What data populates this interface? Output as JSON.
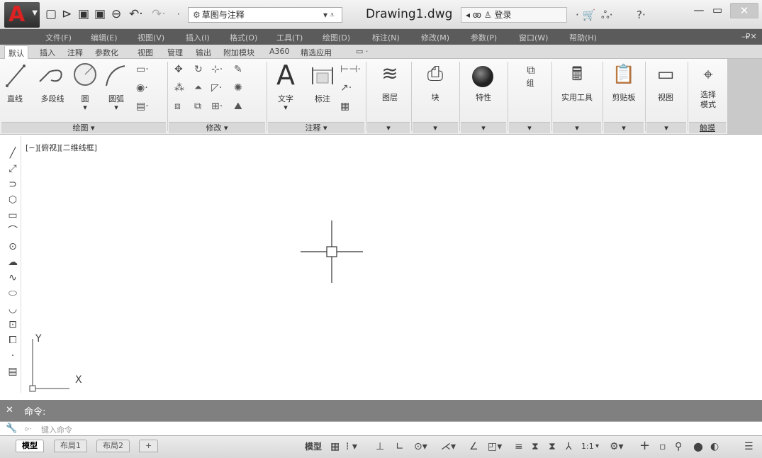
{
  "app": {
    "doc_title": "Drawing1.dwg"
  },
  "qat": {
    "workspace": "草图与注释",
    "search_placeholder": "",
    "login": "登录"
  },
  "menu": [
    "文件(F)",
    "编辑(E)",
    "视图(V)",
    "插入(I)",
    "格式(O)",
    "工具(T)",
    "绘图(D)",
    "标注(N)",
    "修改(M)",
    "参数(P)",
    "窗口(W)",
    "帮助(H)"
  ],
  "tabs": [
    "默认",
    "插入",
    "注释",
    "参数化",
    "视图",
    "管理",
    "输出",
    "附加模块",
    "A360",
    "精选应用"
  ],
  "ribbon": {
    "draw": {
      "line": "直线",
      "polyline": "多段线",
      "circle": "圆",
      "arc": "圆弧",
      "panel": "绘图 ▾"
    },
    "modify": {
      "panel": "修改 ▾"
    },
    "annotation": {
      "text": "文字",
      "dim": "标注",
      "panel": "注释 ▾"
    },
    "layers": "图层",
    "block": "块",
    "properties": "特性",
    "group": "组",
    "utilities": "实用工具",
    "clipboard": "剪贴板",
    "view": "视图",
    "select_mode": "选择\n模式",
    "touch": "触摸"
  },
  "viewport": {
    "label": "[−][俯视][二维线框]",
    "ucs_x": "X",
    "ucs_y": "Y"
  },
  "command": {
    "history_label": "命令:",
    "input_placeholder": "键入命令"
  },
  "layout_tabs": [
    "模型",
    "布局1",
    "布局2",
    "+"
  ],
  "status": {
    "model": "模型",
    "scale": "1:1"
  }
}
